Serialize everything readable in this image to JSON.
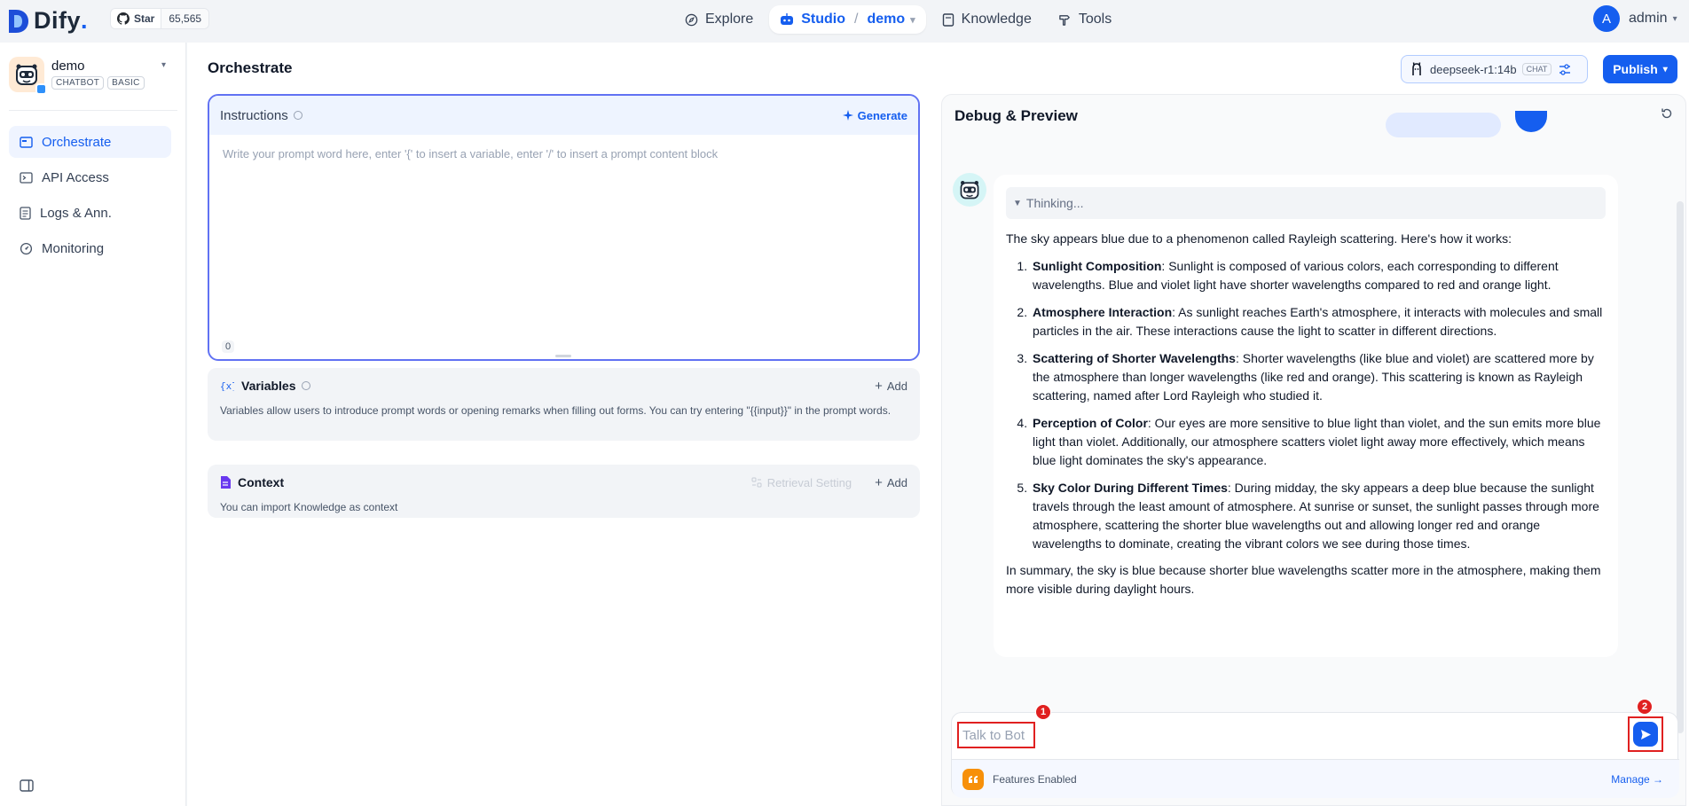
{
  "brand": {
    "name": "Dify",
    "github_star_label": "Star",
    "github_star_count": "65,565"
  },
  "nav": {
    "explore": "Explore",
    "studio": "Studio",
    "studio_app": "demo",
    "knowledge": "Knowledge",
    "tools": "Tools"
  },
  "account": {
    "initial": "A",
    "name": "admin"
  },
  "app": {
    "name": "demo",
    "tags": [
      "CHATBOT",
      "BASIC"
    ]
  },
  "sidebar": {
    "items": [
      {
        "label": "Orchestrate",
        "icon": "orchestrate-icon",
        "active": true
      },
      {
        "label": "API Access",
        "icon": "terminal-icon",
        "active": false
      },
      {
        "label": "Logs & Ann.",
        "icon": "document-icon",
        "active": false
      },
      {
        "label": "Monitoring",
        "icon": "gauge-icon",
        "active": false
      }
    ]
  },
  "page": {
    "title": "Orchestrate"
  },
  "model": {
    "name": "deepseek-r1:14b",
    "mode_tag": "CHAT"
  },
  "publish": {
    "label": "Publish"
  },
  "instructions": {
    "title": "Instructions",
    "generate_label": "Generate",
    "placeholder": "Write your prompt word here, enter '{' to insert a variable, enter '/' to insert a prompt content block",
    "char_count": "0"
  },
  "variables": {
    "title": "Variables",
    "add_label": "Add",
    "description": "Variables allow users to introduce prompt words or opening remarks when filling out forms. You can try entering \"{{input}}\" in the prompt words."
  },
  "context": {
    "title": "Context",
    "retrieval_label": "Retrieval Setting",
    "add_label": "Add",
    "description": "You can import Knowledge as context"
  },
  "debug": {
    "title": "Debug & Preview",
    "thinking_label": "Thinking...",
    "intro": "The sky appears blue due to a phenomenon called Rayleigh scattering. Here's how it works:",
    "points": [
      {
        "title": "Sunlight Composition",
        "text": ": Sunlight is composed of various colors, each corresponding to different wavelengths. Blue and violet light have shorter wavelengths compared to red and orange light."
      },
      {
        "title": "Atmosphere Interaction",
        "text": ": As sunlight reaches Earth's atmosphere, it interacts with molecules and small particles in the air. These interactions cause the light to scatter in different directions."
      },
      {
        "title": "Scattering of Shorter Wavelengths",
        "text": ": Shorter wavelengths (like blue and violet) are scattered more by the atmosphere than longer wavelengths (like red and orange). This scattering is known as Rayleigh scattering, named after Lord Rayleigh who studied it."
      },
      {
        "title": "Perception of Color",
        "text": ": Our eyes are more sensitive to blue light than violet, and the sun emits more blue light than violet. Additionally, our atmosphere scatters violet light away more effectively, which means blue light dominates the sky's appearance."
      },
      {
        "title": "Sky Color During Different Times",
        "text": ": During midday, the sky appears a deep blue because the sunlight travels through the least amount of atmosphere. At sunrise or sunset, the sunlight passes through more atmosphere, scattering the shorter blue wavelengths out and allowing longer red and orange wavelengths to dominate, creating the vibrant colors we see during those times."
      }
    ],
    "summary": "In summary, the sky is blue because shorter blue wavelengths scatter more in the atmosphere, making them more visible during daylight hours.",
    "input_placeholder": "Talk to Bot",
    "features_label": "Features Enabled",
    "manage_label": "Manage →",
    "markers": [
      "1",
      "2"
    ]
  },
  "colors": {
    "accent": "#155eef",
    "highlight_border": "#e02020",
    "instructions_border": "#6172f3"
  }
}
